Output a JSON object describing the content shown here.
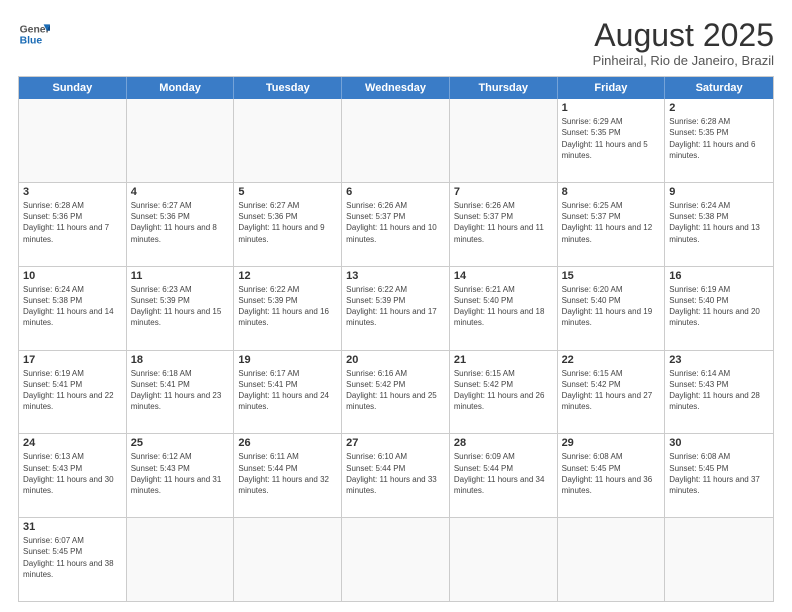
{
  "header": {
    "logo_general": "General",
    "logo_blue": "Blue",
    "month_title": "August 2025",
    "subtitle": "Pinheiral, Rio de Janeiro, Brazil"
  },
  "days_of_week": [
    "Sunday",
    "Monday",
    "Tuesday",
    "Wednesday",
    "Thursday",
    "Friday",
    "Saturday"
  ],
  "weeks": [
    [
      {
        "day": "",
        "empty": true
      },
      {
        "day": "",
        "empty": true
      },
      {
        "day": "",
        "empty": true
      },
      {
        "day": "",
        "empty": true
      },
      {
        "day": "",
        "empty": true
      },
      {
        "day": "1",
        "sunrise": "6:29 AM",
        "sunset": "5:35 PM",
        "daylight": "11 hours and 5 minutes."
      },
      {
        "day": "2",
        "sunrise": "6:28 AM",
        "sunset": "5:35 PM",
        "daylight": "11 hours and 6 minutes."
      }
    ],
    [
      {
        "day": "3",
        "sunrise": "6:28 AM",
        "sunset": "5:36 PM",
        "daylight": "11 hours and 7 minutes."
      },
      {
        "day": "4",
        "sunrise": "6:27 AM",
        "sunset": "5:36 PM",
        "daylight": "11 hours and 8 minutes."
      },
      {
        "day": "5",
        "sunrise": "6:27 AM",
        "sunset": "5:36 PM",
        "daylight": "11 hours and 9 minutes."
      },
      {
        "day": "6",
        "sunrise": "6:26 AM",
        "sunset": "5:37 PM",
        "daylight": "11 hours and 10 minutes."
      },
      {
        "day": "7",
        "sunrise": "6:26 AM",
        "sunset": "5:37 PM",
        "daylight": "11 hours and 11 minutes."
      },
      {
        "day": "8",
        "sunrise": "6:25 AM",
        "sunset": "5:37 PM",
        "daylight": "11 hours and 12 minutes."
      },
      {
        "day": "9",
        "sunrise": "6:24 AM",
        "sunset": "5:38 PM",
        "daylight": "11 hours and 13 minutes."
      }
    ],
    [
      {
        "day": "10",
        "sunrise": "6:24 AM",
        "sunset": "5:38 PM",
        "daylight": "11 hours and 14 minutes."
      },
      {
        "day": "11",
        "sunrise": "6:23 AM",
        "sunset": "5:39 PM",
        "daylight": "11 hours and 15 minutes."
      },
      {
        "day": "12",
        "sunrise": "6:22 AM",
        "sunset": "5:39 PM",
        "daylight": "11 hours and 16 minutes."
      },
      {
        "day": "13",
        "sunrise": "6:22 AM",
        "sunset": "5:39 PM",
        "daylight": "11 hours and 17 minutes."
      },
      {
        "day": "14",
        "sunrise": "6:21 AM",
        "sunset": "5:40 PM",
        "daylight": "11 hours and 18 minutes."
      },
      {
        "day": "15",
        "sunrise": "6:20 AM",
        "sunset": "5:40 PM",
        "daylight": "11 hours and 19 minutes."
      },
      {
        "day": "16",
        "sunrise": "6:19 AM",
        "sunset": "5:40 PM",
        "daylight": "11 hours and 20 minutes."
      }
    ],
    [
      {
        "day": "17",
        "sunrise": "6:19 AM",
        "sunset": "5:41 PM",
        "daylight": "11 hours and 22 minutes."
      },
      {
        "day": "18",
        "sunrise": "6:18 AM",
        "sunset": "5:41 PM",
        "daylight": "11 hours and 23 minutes."
      },
      {
        "day": "19",
        "sunrise": "6:17 AM",
        "sunset": "5:41 PM",
        "daylight": "11 hours and 24 minutes."
      },
      {
        "day": "20",
        "sunrise": "6:16 AM",
        "sunset": "5:42 PM",
        "daylight": "11 hours and 25 minutes."
      },
      {
        "day": "21",
        "sunrise": "6:15 AM",
        "sunset": "5:42 PM",
        "daylight": "11 hours and 26 minutes."
      },
      {
        "day": "22",
        "sunrise": "6:15 AM",
        "sunset": "5:42 PM",
        "daylight": "11 hours and 27 minutes."
      },
      {
        "day": "23",
        "sunrise": "6:14 AM",
        "sunset": "5:43 PM",
        "daylight": "11 hours and 28 minutes."
      }
    ],
    [
      {
        "day": "24",
        "sunrise": "6:13 AM",
        "sunset": "5:43 PM",
        "daylight": "11 hours and 30 minutes."
      },
      {
        "day": "25",
        "sunrise": "6:12 AM",
        "sunset": "5:43 PM",
        "daylight": "11 hours and 31 minutes."
      },
      {
        "day": "26",
        "sunrise": "6:11 AM",
        "sunset": "5:44 PM",
        "daylight": "11 hours and 32 minutes."
      },
      {
        "day": "27",
        "sunrise": "6:10 AM",
        "sunset": "5:44 PM",
        "daylight": "11 hours and 33 minutes."
      },
      {
        "day": "28",
        "sunrise": "6:09 AM",
        "sunset": "5:44 PM",
        "daylight": "11 hours and 34 minutes."
      },
      {
        "day": "29",
        "sunrise": "6:08 AM",
        "sunset": "5:45 PM",
        "daylight": "11 hours and 36 minutes."
      },
      {
        "day": "30",
        "sunrise": "6:08 AM",
        "sunset": "5:45 PM",
        "daylight": "11 hours and 37 minutes."
      }
    ],
    [
      {
        "day": "31",
        "sunrise": "6:07 AM",
        "sunset": "5:45 PM",
        "daylight": "11 hours and 38 minutes."
      },
      {
        "day": "",
        "empty": true
      },
      {
        "day": "",
        "empty": true
      },
      {
        "day": "",
        "empty": true
      },
      {
        "day": "",
        "empty": true
      },
      {
        "day": "",
        "empty": true
      },
      {
        "day": "",
        "empty": true
      }
    ]
  ]
}
